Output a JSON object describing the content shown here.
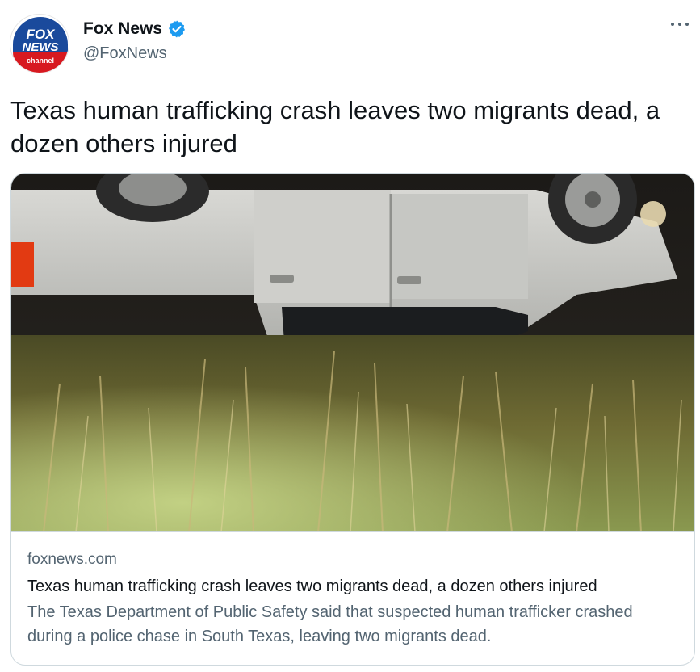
{
  "author": {
    "display_name": "Fox News",
    "handle": "@FoxNews",
    "verified": true,
    "avatar_logo_text": [
      "FOX",
      "NEWS",
      "channel"
    ]
  },
  "tweet": {
    "text": "Texas human trafficking crash leaves two migrants dead, a dozen others injured"
  },
  "card": {
    "domain": "foxnews.com",
    "title": "Texas human trafficking crash leaves two migrants dead, a dozen others injured",
    "description": "The Texas Department of Public Safety said that suspected human trafficker crashed during a police chase in South Texas, leaving two migrants dead."
  },
  "icons": {
    "verified": "verified-badge-icon",
    "more": "more-options-icon"
  },
  "colors": {
    "verified_blue": "#1d9bf0",
    "fox_blue": "#1a4a9c",
    "fox_red": "#d71920",
    "secondary_text": "#536471",
    "border": "#cfd9de"
  }
}
